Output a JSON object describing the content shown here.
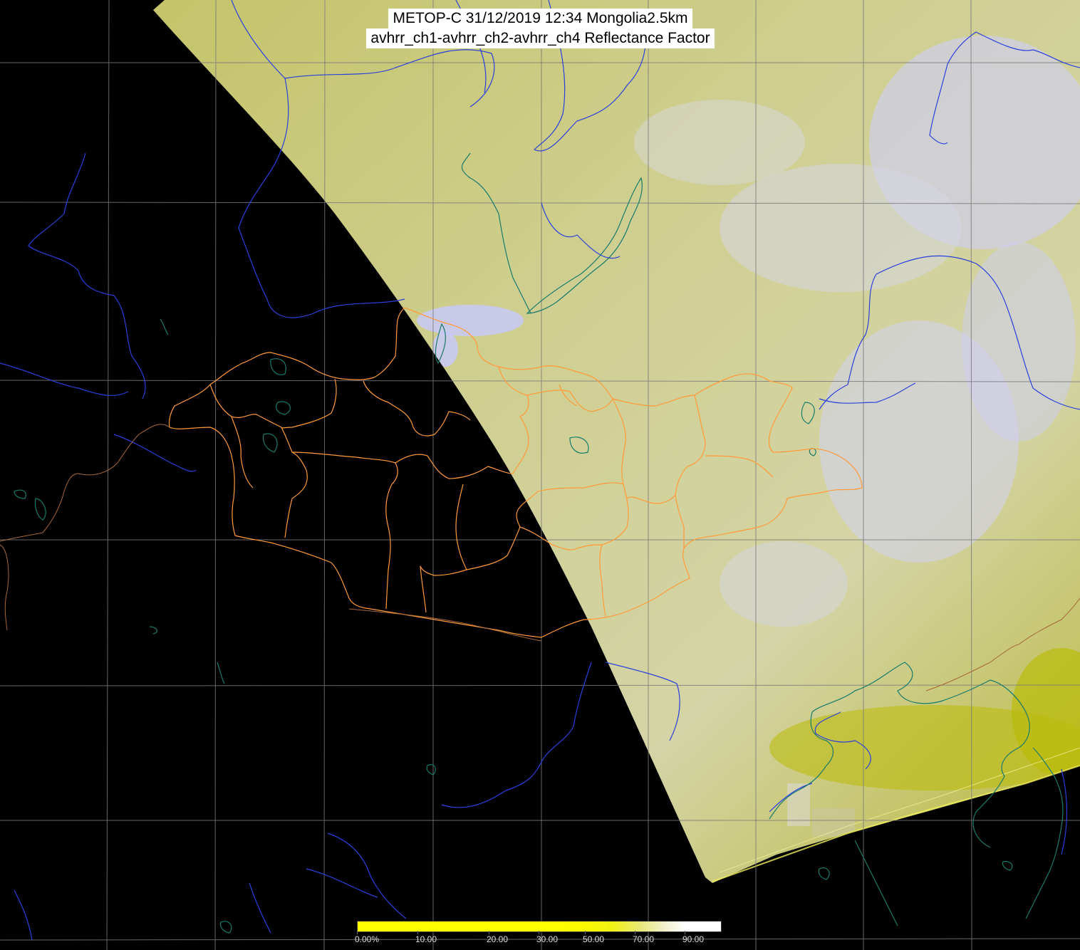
{
  "title": {
    "line1": "METOP-C 31/12/2019 12:34 Mongolia2.5km",
    "line2": "avhrr_ch1-avhrr_ch2-avhrr_ch4 Reflectance Factor"
  },
  "colorbar": {
    "ticks": [
      {
        "label": "0.00%",
        "value": 0
      },
      {
        "label": "10.00",
        "value": 10
      },
      {
        "label": "20.00",
        "value": 20
      },
      {
        "label": "30.00",
        "value": 30
      },
      {
        "label": "50.00",
        "value": 50
      },
      {
        "label": "70.00",
        "value": 70
      },
      {
        "label": "90.00",
        "value": 90
      }
    ],
    "colors": {
      "low": "#ffff00",
      "mid": "#e8e87a",
      "high": "#ffffff"
    }
  },
  "map": {
    "colors": {
      "background": "#000000",
      "swath_base": "#c2c25c",
      "swath_bright": "#d8d8b0",
      "cloud": "#c8c8f0",
      "graticule": "#888888",
      "rivers": "#2a3cd8",
      "lakes_coast": "#1a7a6a",
      "admin_borders": "#ff9a3a"
    }
  }
}
